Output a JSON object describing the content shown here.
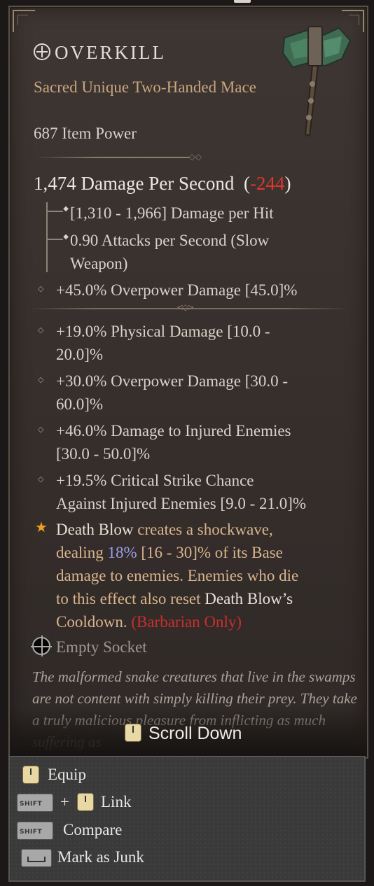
{
  "item": {
    "name": "OVERKILL",
    "subtitle": "Sacred Unique Two-Handed Mace",
    "item_power": "687 Item Power",
    "dps": "1,474 Damage Per Second",
    "dps_open": "(",
    "dps_delta": "-244",
    "dps_close": ")",
    "damage_per_hit": "[1,310 - 1,966] Damage per Hit",
    "attacks_per_second_line1": "0.90 Attacks per Second (Slow",
    "attacks_per_second_line2": "Weapon)",
    "implicit": "+45.0% Overpower Damage [45.0]%",
    "affixes": [
      {
        "line1": "+19.0% Physical Damage [10.0 -",
        "line2": "20.0]%"
      },
      {
        "line1": "+30.0% Overpower Damage [30.0 -",
        "line2": "60.0]%"
      },
      {
        "line1": "+46.0% Damage to Injured Enemies",
        "line2": "[30.0 - 50.0]%"
      },
      {
        "line1": "+19.5% Critical Strike Chance",
        "line2": "Against Injured Enemies [9.0 - 21.0]%"
      }
    ],
    "unique_power": {
      "skill": "Death Blow",
      "p1": " creates a shockwave,",
      "p2": "dealing ",
      "value": "18%",
      "range": " [16 - 30]% of its Base",
      "p3": "damage to enemies. Enemies who die",
      "p4": "to this effect also reset ",
      "skill2": "Death Blow’s",
      "p5": "Cooldown. ",
      "class_req": "(Barbarian Only)"
    },
    "socket": "Empty Socket",
    "flavor": "The malformed snake creatures that live in the swamps are not content with simply killing their prey. They take a truly malicious pleasure from inflicting as much suffering as"
  },
  "scroll_hint": "Scroll Down",
  "actions": {
    "equip": "Equip",
    "plus": "+",
    "link": "Link",
    "compare": "Compare",
    "mark_junk": "Mark as Junk",
    "shift_key": "SHIFT"
  },
  "icons": {
    "title": "crosshair-circle-icon",
    "weapon": "mace-icon",
    "socket": "socket-icon",
    "unique": "star-icon",
    "mouse": "left-mouse-icon"
  },
  "colors": {
    "unique": "#c8a57e",
    "negative": "#e0372d",
    "roll_value": "#9c9ee8",
    "class_restriction": "#c8302a",
    "star": "#f0a020"
  }
}
